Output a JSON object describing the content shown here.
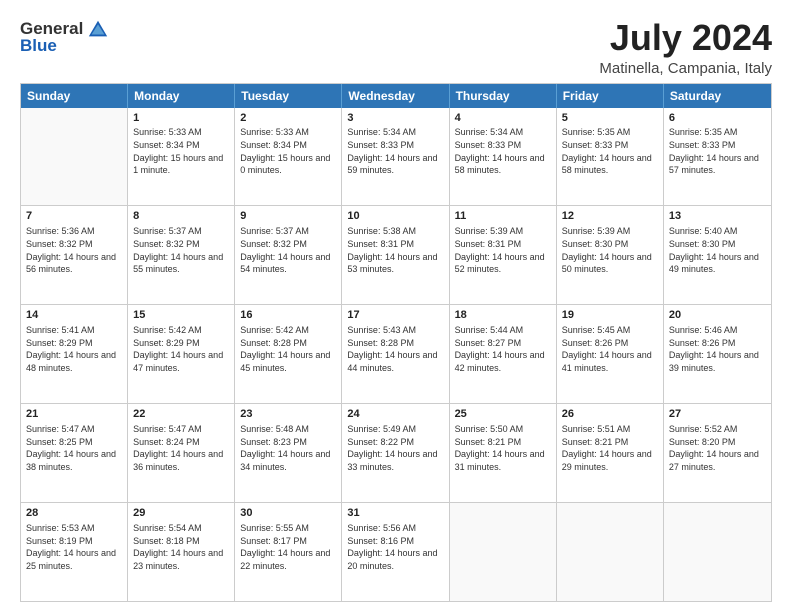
{
  "logo": {
    "general": "General",
    "blue": "Blue"
  },
  "header": {
    "month": "July 2024",
    "location": "Matinella, Campania, Italy"
  },
  "weekdays": [
    "Sunday",
    "Monday",
    "Tuesday",
    "Wednesday",
    "Thursday",
    "Friday",
    "Saturday"
  ],
  "rows": [
    [
      {
        "day": "",
        "sunrise": "",
        "sunset": "",
        "daylight": "",
        "empty": true
      },
      {
        "day": "1",
        "sunrise": "Sunrise: 5:33 AM",
        "sunset": "Sunset: 8:34 PM",
        "daylight": "Daylight: 15 hours and 1 minute."
      },
      {
        "day": "2",
        "sunrise": "Sunrise: 5:33 AM",
        "sunset": "Sunset: 8:34 PM",
        "daylight": "Daylight: 15 hours and 0 minutes."
      },
      {
        "day": "3",
        "sunrise": "Sunrise: 5:34 AM",
        "sunset": "Sunset: 8:33 PM",
        "daylight": "Daylight: 14 hours and 59 minutes."
      },
      {
        "day": "4",
        "sunrise": "Sunrise: 5:34 AM",
        "sunset": "Sunset: 8:33 PM",
        "daylight": "Daylight: 14 hours and 58 minutes."
      },
      {
        "day": "5",
        "sunrise": "Sunrise: 5:35 AM",
        "sunset": "Sunset: 8:33 PM",
        "daylight": "Daylight: 14 hours and 58 minutes."
      },
      {
        "day": "6",
        "sunrise": "Sunrise: 5:35 AM",
        "sunset": "Sunset: 8:33 PM",
        "daylight": "Daylight: 14 hours and 57 minutes."
      }
    ],
    [
      {
        "day": "7",
        "sunrise": "Sunrise: 5:36 AM",
        "sunset": "Sunset: 8:32 PM",
        "daylight": "Daylight: 14 hours and 56 minutes."
      },
      {
        "day": "8",
        "sunrise": "Sunrise: 5:37 AM",
        "sunset": "Sunset: 8:32 PM",
        "daylight": "Daylight: 14 hours and 55 minutes."
      },
      {
        "day": "9",
        "sunrise": "Sunrise: 5:37 AM",
        "sunset": "Sunset: 8:32 PM",
        "daylight": "Daylight: 14 hours and 54 minutes."
      },
      {
        "day": "10",
        "sunrise": "Sunrise: 5:38 AM",
        "sunset": "Sunset: 8:31 PM",
        "daylight": "Daylight: 14 hours and 53 minutes."
      },
      {
        "day": "11",
        "sunrise": "Sunrise: 5:39 AM",
        "sunset": "Sunset: 8:31 PM",
        "daylight": "Daylight: 14 hours and 52 minutes."
      },
      {
        "day": "12",
        "sunrise": "Sunrise: 5:39 AM",
        "sunset": "Sunset: 8:30 PM",
        "daylight": "Daylight: 14 hours and 50 minutes."
      },
      {
        "day": "13",
        "sunrise": "Sunrise: 5:40 AM",
        "sunset": "Sunset: 8:30 PM",
        "daylight": "Daylight: 14 hours and 49 minutes."
      }
    ],
    [
      {
        "day": "14",
        "sunrise": "Sunrise: 5:41 AM",
        "sunset": "Sunset: 8:29 PM",
        "daylight": "Daylight: 14 hours and 48 minutes."
      },
      {
        "day": "15",
        "sunrise": "Sunrise: 5:42 AM",
        "sunset": "Sunset: 8:29 PM",
        "daylight": "Daylight: 14 hours and 47 minutes."
      },
      {
        "day": "16",
        "sunrise": "Sunrise: 5:42 AM",
        "sunset": "Sunset: 8:28 PM",
        "daylight": "Daylight: 14 hours and 45 minutes."
      },
      {
        "day": "17",
        "sunrise": "Sunrise: 5:43 AM",
        "sunset": "Sunset: 8:28 PM",
        "daylight": "Daylight: 14 hours and 44 minutes."
      },
      {
        "day": "18",
        "sunrise": "Sunrise: 5:44 AM",
        "sunset": "Sunset: 8:27 PM",
        "daylight": "Daylight: 14 hours and 42 minutes."
      },
      {
        "day": "19",
        "sunrise": "Sunrise: 5:45 AM",
        "sunset": "Sunset: 8:26 PM",
        "daylight": "Daylight: 14 hours and 41 minutes."
      },
      {
        "day": "20",
        "sunrise": "Sunrise: 5:46 AM",
        "sunset": "Sunset: 8:26 PM",
        "daylight": "Daylight: 14 hours and 39 minutes."
      }
    ],
    [
      {
        "day": "21",
        "sunrise": "Sunrise: 5:47 AM",
        "sunset": "Sunset: 8:25 PM",
        "daylight": "Daylight: 14 hours and 38 minutes."
      },
      {
        "day": "22",
        "sunrise": "Sunrise: 5:47 AM",
        "sunset": "Sunset: 8:24 PM",
        "daylight": "Daylight: 14 hours and 36 minutes."
      },
      {
        "day": "23",
        "sunrise": "Sunrise: 5:48 AM",
        "sunset": "Sunset: 8:23 PM",
        "daylight": "Daylight: 14 hours and 34 minutes."
      },
      {
        "day": "24",
        "sunrise": "Sunrise: 5:49 AM",
        "sunset": "Sunset: 8:22 PM",
        "daylight": "Daylight: 14 hours and 33 minutes."
      },
      {
        "day": "25",
        "sunrise": "Sunrise: 5:50 AM",
        "sunset": "Sunset: 8:21 PM",
        "daylight": "Daylight: 14 hours and 31 minutes."
      },
      {
        "day": "26",
        "sunrise": "Sunrise: 5:51 AM",
        "sunset": "Sunset: 8:21 PM",
        "daylight": "Daylight: 14 hours and 29 minutes."
      },
      {
        "day": "27",
        "sunrise": "Sunrise: 5:52 AM",
        "sunset": "Sunset: 8:20 PM",
        "daylight": "Daylight: 14 hours and 27 minutes."
      }
    ],
    [
      {
        "day": "28",
        "sunrise": "Sunrise: 5:53 AM",
        "sunset": "Sunset: 8:19 PM",
        "daylight": "Daylight: 14 hours and 25 minutes."
      },
      {
        "day": "29",
        "sunrise": "Sunrise: 5:54 AM",
        "sunset": "Sunset: 8:18 PM",
        "daylight": "Daylight: 14 hours and 23 minutes."
      },
      {
        "day": "30",
        "sunrise": "Sunrise: 5:55 AM",
        "sunset": "Sunset: 8:17 PM",
        "daylight": "Daylight: 14 hours and 22 minutes."
      },
      {
        "day": "31",
        "sunrise": "Sunrise: 5:56 AM",
        "sunset": "Sunset: 8:16 PM",
        "daylight": "Daylight: 14 hours and 20 minutes."
      },
      {
        "day": "",
        "sunrise": "",
        "sunset": "",
        "daylight": "",
        "empty": true
      },
      {
        "day": "",
        "sunrise": "",
        "sunset": "",
        "daylight": "",
        "empty": true
      },
      {
        "day": "",
        "sunrise": "",
        "sunset": "",
        "daylight": "",
        "empty": true
      }
    ]
  ]
}
